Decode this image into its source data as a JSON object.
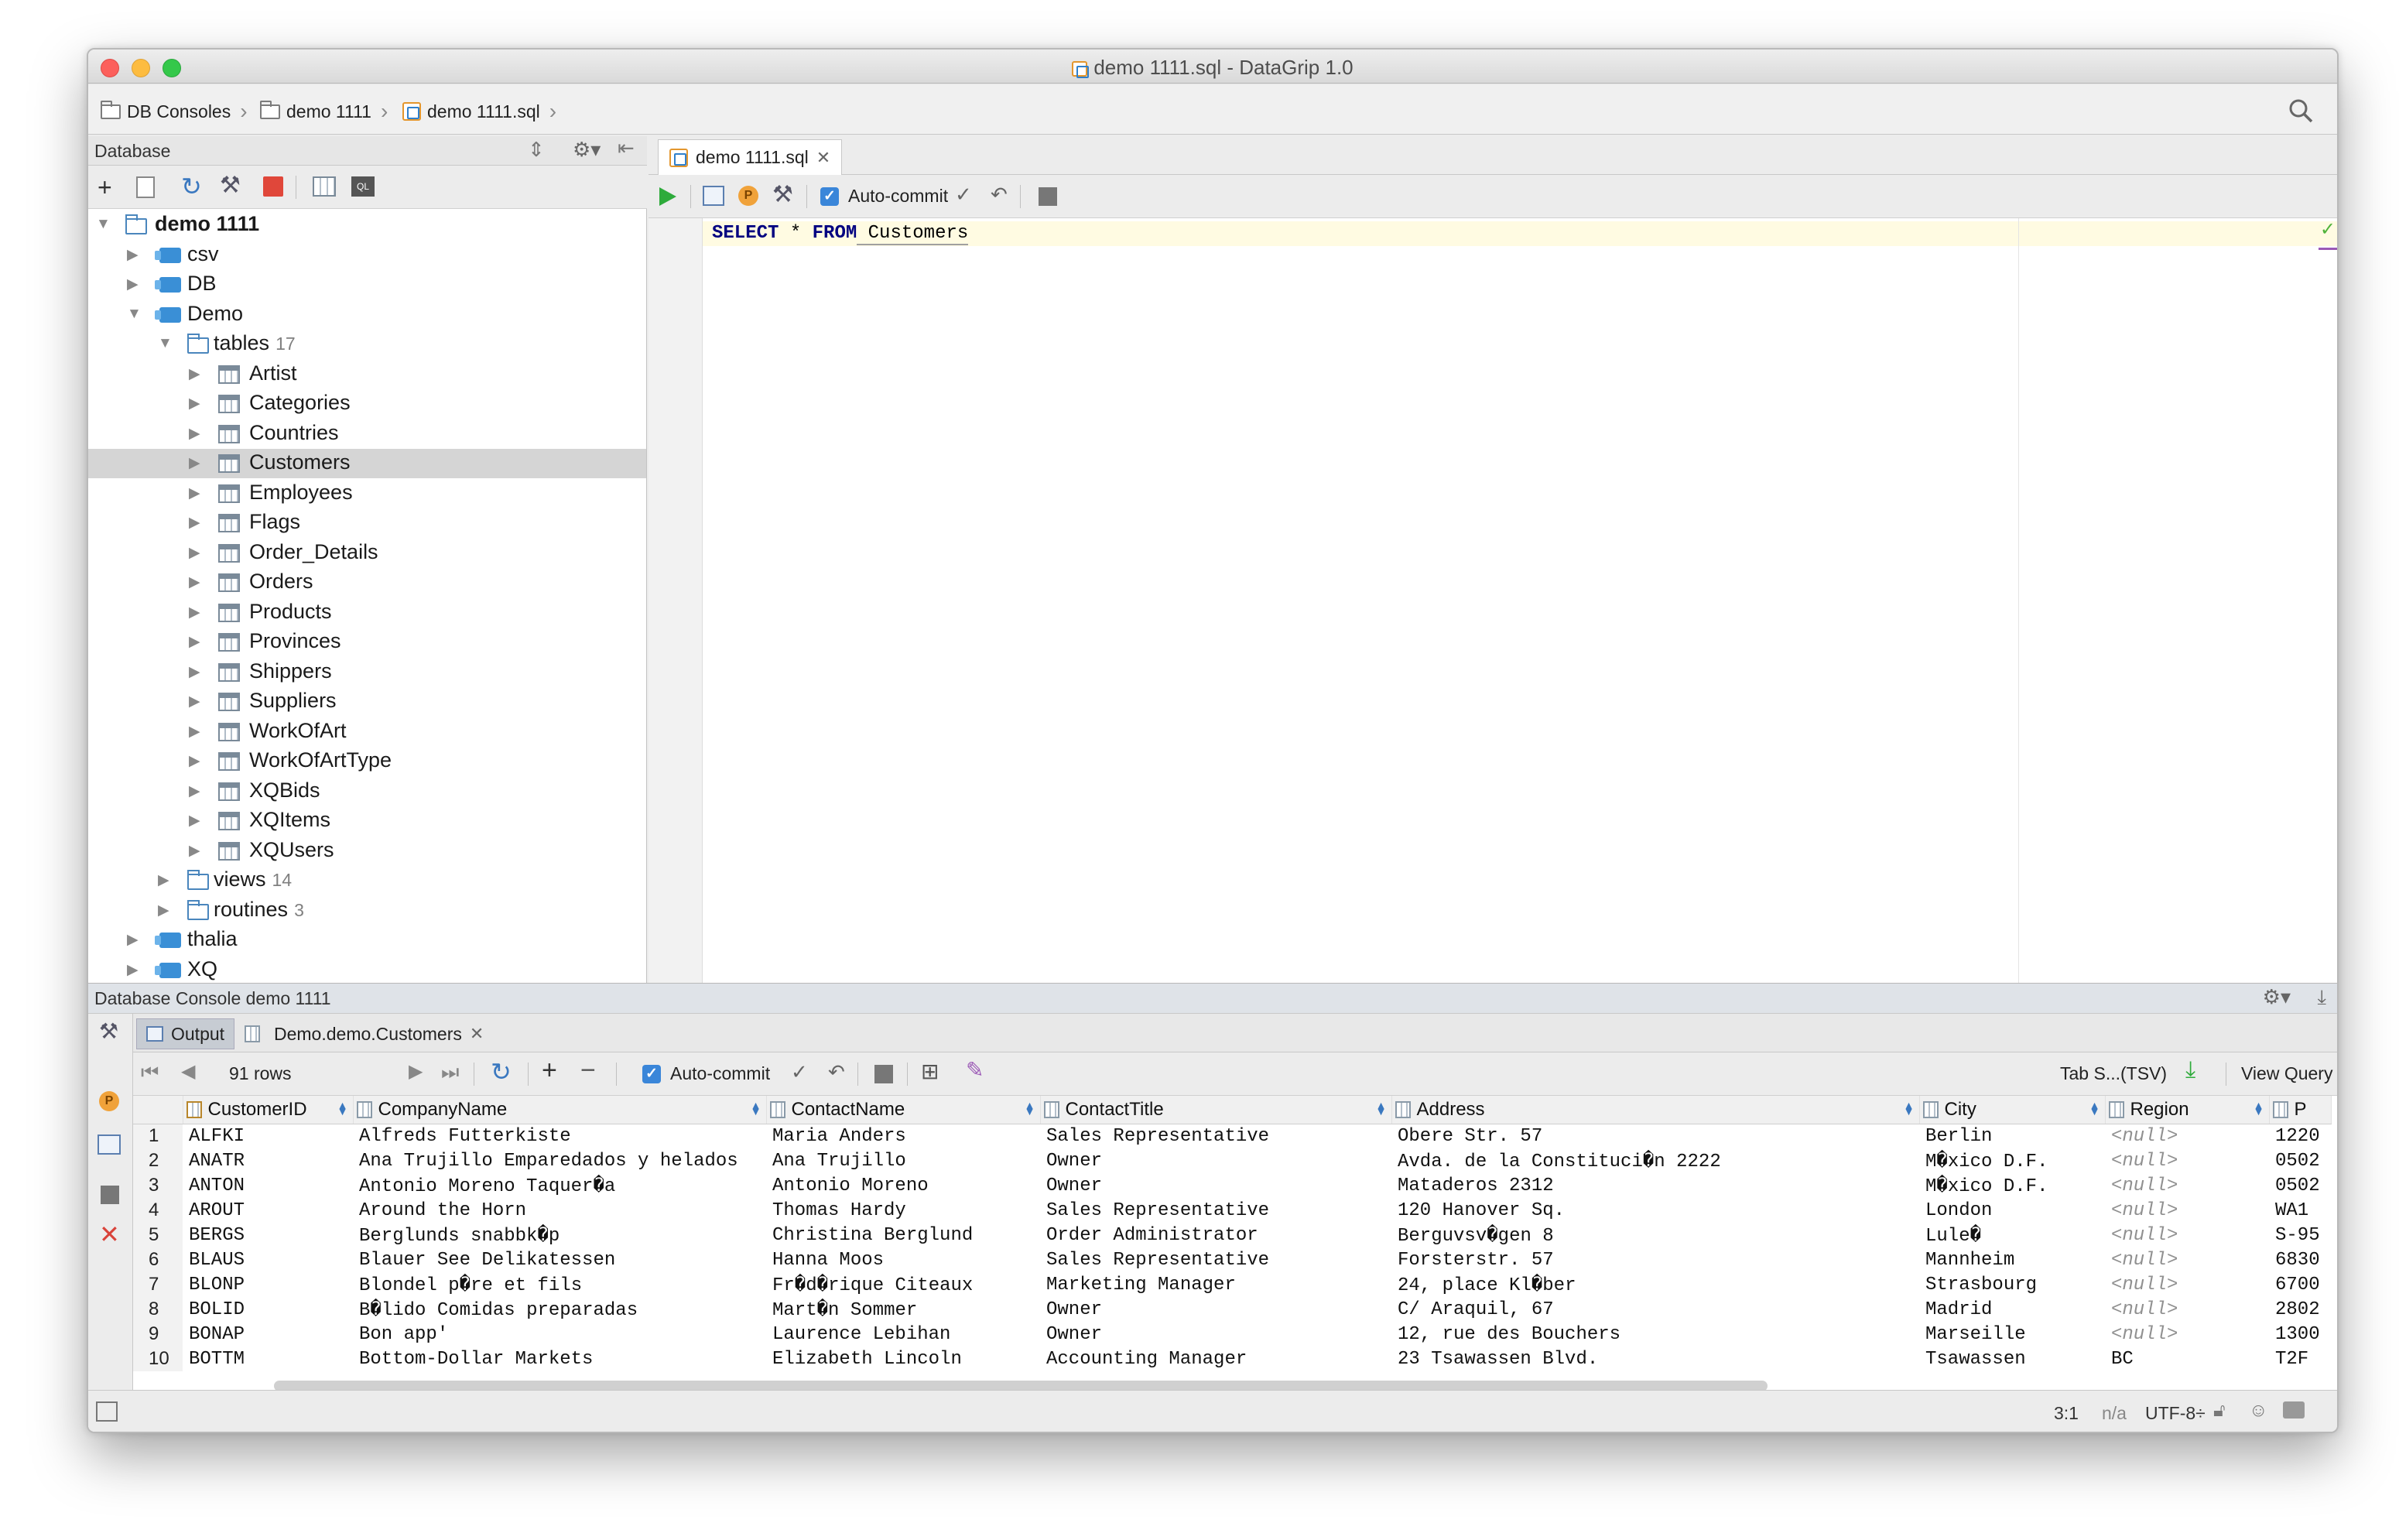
{
  "window": {
    "title": "demo 1111.sql - DataGrip 1.0"
  },
  "breadcrumbs": [
    "DB Consoles",
    "demo 1111",
    "demo 1111.sql"
  ],
  "database_panel": {
    "title": "Database",
    "root": "demo 1111",
    "schemas": [
      "csv",
      "DB",
      "Demo",
      "thalia",
      "XQ"
    ],
    "tables_label": "tables",
    "tables_count": "17",
    "tables": [
      "Artist",
      "Categories",
      "Countries",
      "Customers",
      "Employees",
      "Flags",
      "Order_Details",
      "Orders",
      "Products",
      "Provinces",
      "Shippers",
      "Suppliers",
      "WorkOfArt",
      "WorkOfArtType",
      "XQBids",
      "XQItems",
      "XQUsers"
    ],
    "selected_table": "Customers",
    "views_label": "views",
    "views_count": "14",
    "routines_label": "routines",
    "routines_count": "3"
  },
  "editor": {
    "tab": "demo 1111.sql",
    "autocommit_label": "Auto-commit",
    "code": {
      "kw1": "SELECT",
      "op": " * ",
      "kw2": "FROM",
      "ident": " Customers"
    }
  },
  "console": {
    "title": "Database Console demo 1111",
    "tabs": [
      "Output",
      "Demo.demo.Customers"
    ],
    "rows_label": "91 rows",
    "autocommit_label": "Auto-commit",
    "export_label": "Tab S...(TSV)",
    "view_query_label": "View Query",
    "columns": [
      "CustomerID",
      "CompanyName",
      "ContactName",
      "ContactTitle",
      "Address",
      "City",
      "Region",
      "P"
    ],
    "rows": [
      [
        "1",
        "ALFKI",
        "Alfreds Futterkiste",
        "Maria Anders",
        "Sales Representative",
        "Obere Str. 57",
        "Berlin",
        "<null>",
        "1220"
      ],
      [
        "2",
        "ANATR",
        "Ana Trujillo Emparedados y helados",
        "Ana Trujillo",
        "Owner",
        "Avda. de la Constituci�n 2222",
        "M�xico D.F.",
        "<null>",
        "0502"
      ],
      [
        "3",
        "ANTON",
        "Antonio Moreno Taquer�a",
        "Antonio Moreno",
        "Owner",
        "Mataderos  2312",
        "M�xico D.F.",
        "<null>",
        "0502"
      ],
      [
        "4",
        "AROUT",
        "Around the Horn",
        "Thomas Hardy",
        "Sales Representative",
        "120 Hanover Sq.",
        "London",
        "<null>",
        "WA1"
      ],
      [
        "5",
        "BERGS",
        "Berglunds snabbk�p",
        "Christina Berglund",
        "Order Administrator",
        "Berguvsv�gen  8",
        "Lule�",
        "<null>",
        "S-95"
      ],
      [
        "6",
        "BLAUS",
        "Blauer See Delikatessen",
        "Hanna Moos",
        "Sales Representative",
        "Forsterstr. 57",
        "Mannheim",
        "<null>",
        "6830"
      ],
      [
        "7",
        "BLONP",
        "Blondel p�re et fils",
        "Fr�d�rique Citeaux",
        "Marketing Manager",
        "24, place Kl�ber",
        "Strasbourg",
        "<null>",
        "6700"
      ],
      [
        "8",
        "BOLID",
        "B�lido Comidas preparadas",
        "Mart�n Sommer",
        "Owner",
        "C/ Araquil, 67",
        "Madrid",
        "<null>",
        "2802"
      ],
      [
        "9",
        "BONAP",
        "Bon app'",
        "Laurence Lebihan",
        "Owner",
        "12, rue des Bouchers",
        "Marseille",
        "<null>",
        "1300"
      ],
      [
        "10",
        "BOTTM",
        "Bottom-Dollar Markets",
        "Elizabeth Lincoln",
        "Accounting Manager",
        "23 Tsawassen Blvd.",
        "Tsawassen",
        "BC",
        "T2F"
      ]
    ]
  },
  "status": {
    "position": "3:1",
    "na": "n/a",
    "encoding": "UTF-8÷"
  }
}
